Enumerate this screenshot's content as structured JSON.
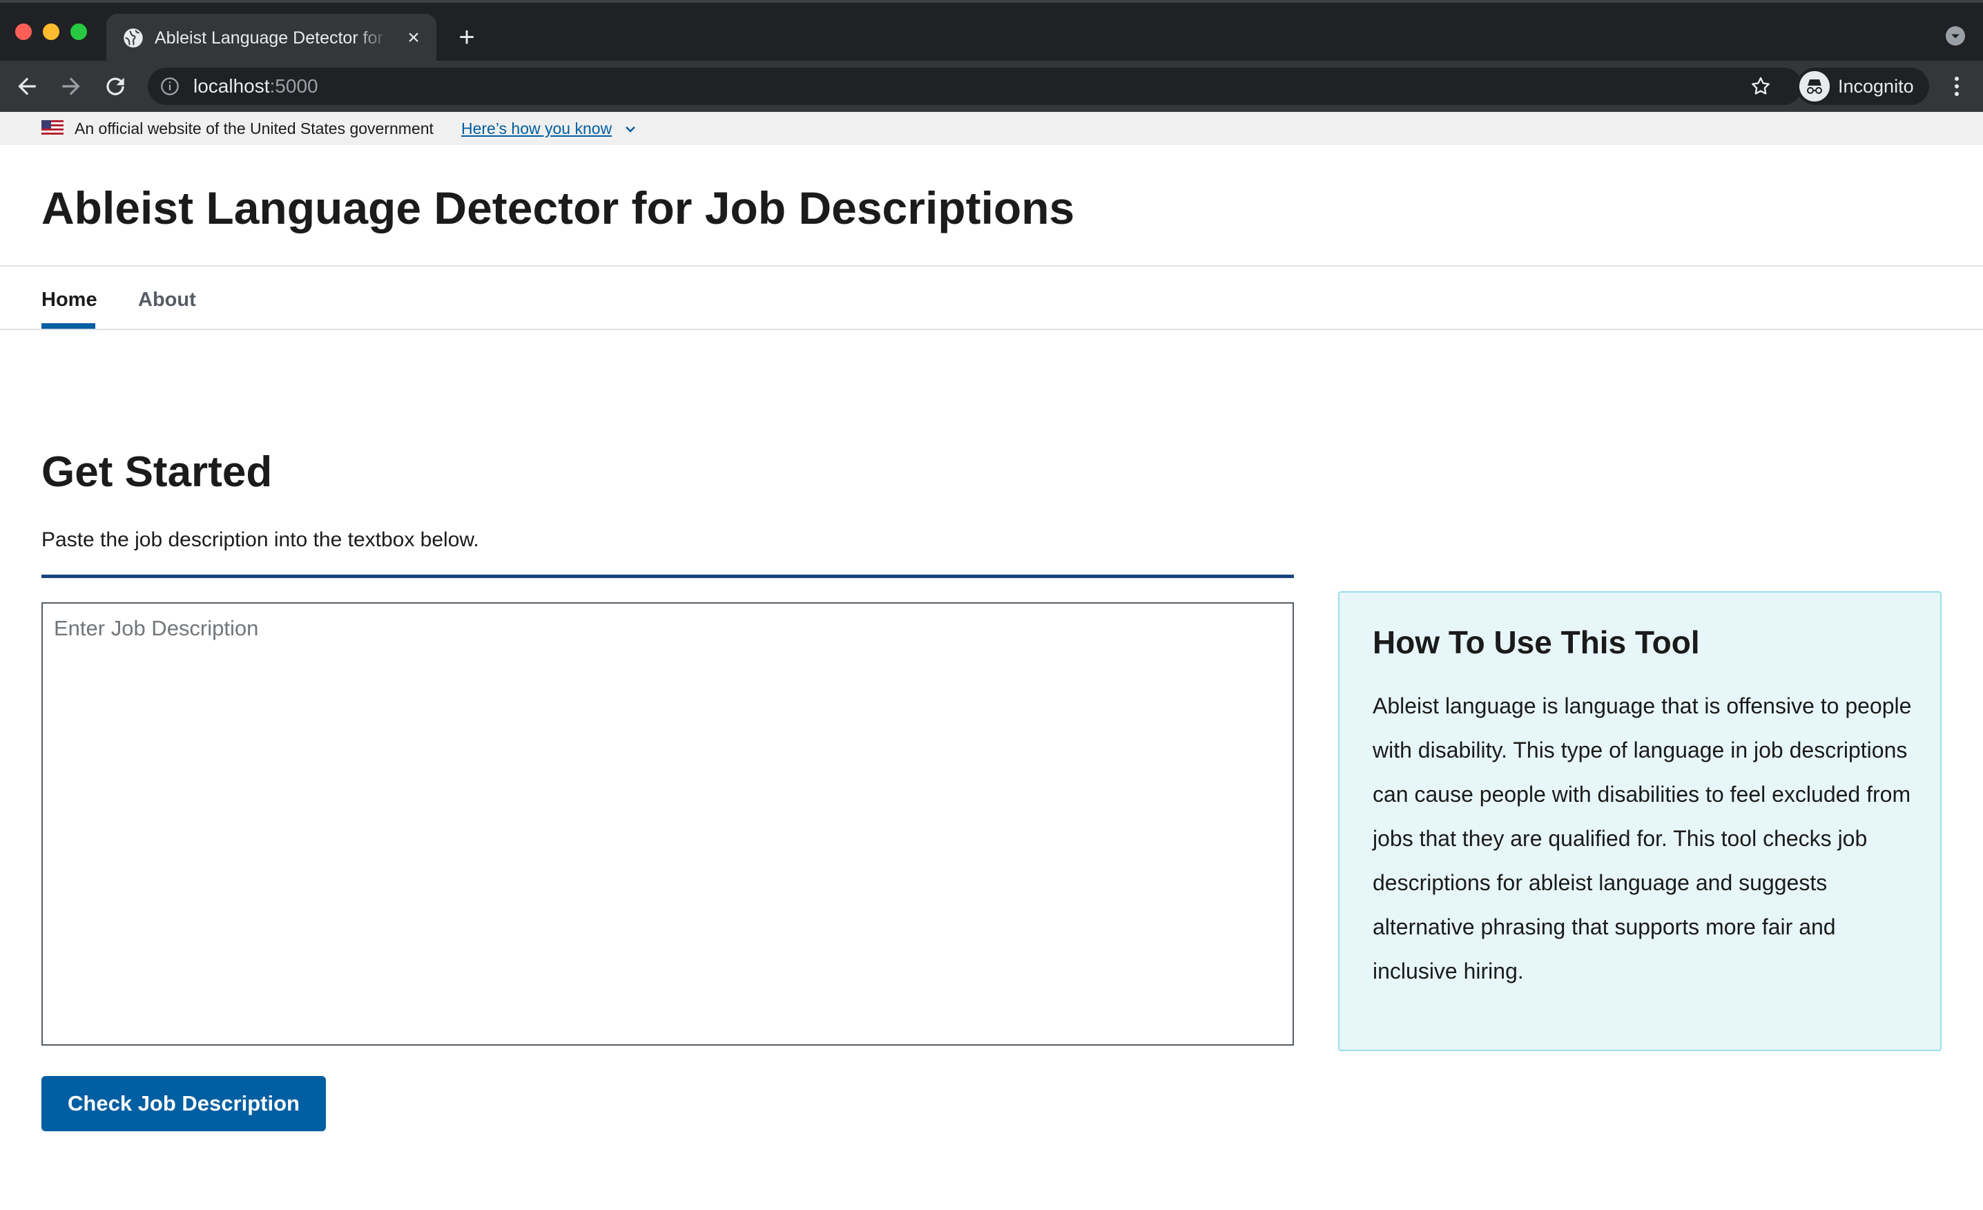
{
  "browser": {
    "tab_title": "Ableist Language Detector for Job Descriptions",
    "url_host": "localhost",
    "url_port": ":5000",
    "profile_label": "Incognito"
  },
  "gov_banner": {
    "text": "An official website of the United States government",
    "link": "Here’s how you know"
  },
  "site": {
    "title": "Ableist Language Detector for Job Descriptions"
  },
  "nav": {
    "items": [
      {
        "label": "Home",
        "active": true
      },
      {
        "label": "About",
        "active": false
      }
    ]
  },
  "main": {
    "heading": "Get Started",
    "intro": "Paste the job description into the textbox below.",
    "textarea": {
      "placeholder": "Enter Job Description",
      "value": ""
    },
    "submit_label": "Check Job Description"
  },
  "sidebar": {
    "title": "How To Use This Tool",
    "body": "Ableist language is language that is offensive to people with disability. This type of language in job descriptions can cause people with disabilities to feel excluded from jobs that they are qualified for. This tool checks job descriptions for ableist language and suggests alternative phrasing that supports more fair and inclusive hiring."
  },
  "colors": {
    "primary": "#005ea2",
    "rule": "#1a4480",
    "card_bg": "#e7f6f8",
    "card_border": "#99deea"
  },
  "icons": [
    "globe-icon",
    "close-icon",
    "plus-icon",
    "chevron-down-icon",
    "back-arrow-icon",
    "forward-arrow-icon",
    "reload-icon",
    "info-icon",
    "star-icon",
    "incognito-icon",
    "kebab-menu-icon",
    "us-flag-icon"
  ]
}
